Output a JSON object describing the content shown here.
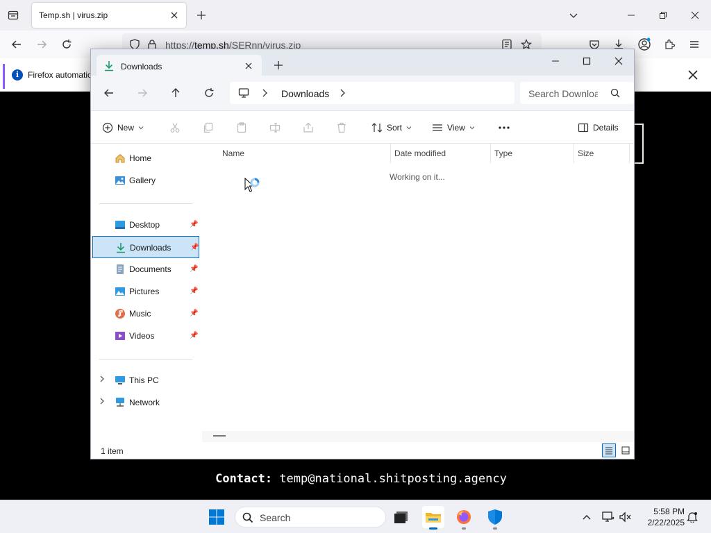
{
  "browser": {
    "tab_title": "Temp.sh | virus.zip",
    "url_prefix": "https://",
    "url_host": "temp.sh",
    "url_path": "/SERnn/virus.zip",
    "notification_text": "Firefox automatio"
  },
  "page": {
    "contact_label": "Contact:",
    "contact_email": "temp@national.shitposting.agency"
  },
  "explorer": {
    "tab_title": "Downloads",
    "breadcrumb": "Downloads",
    "search_placeholder": "Search Downloa",
    "commands": {
      "new": "New",
      "sort": "Sort",
      "view": "View",
      "details": "Details"
    },
    "nav": {
      "home": "Home",
      "gallery": "Gallery",
      "desktop": "Desktop",
      "downloads": "Downloads",
      "documents": "Documents",
      "pictures": "Pictures",
      "music": "Music",
      "videos": "Videos",
      "this_pc": "This PC",
      "network": "Network"
    },
    "columns": {
      "name": "Name",
      "date_modified": "Date modified",
      "type": "Type",
      "size": "Size"
    },
    "loading_text": "Working on it...",
    "status_text": "1 item"
  },
  "taskbar": {
    "search_label": "Search",
    "time": "5:58 PM",
    "date": "2/22/2025"
  },
  "colors": {
    "accent": "#0067c0",
    "selection_bg": "#cce4f7",
    "selection_border": "#0e6fc0",
    "firefox_purple": "#9059ff"
  }
}
